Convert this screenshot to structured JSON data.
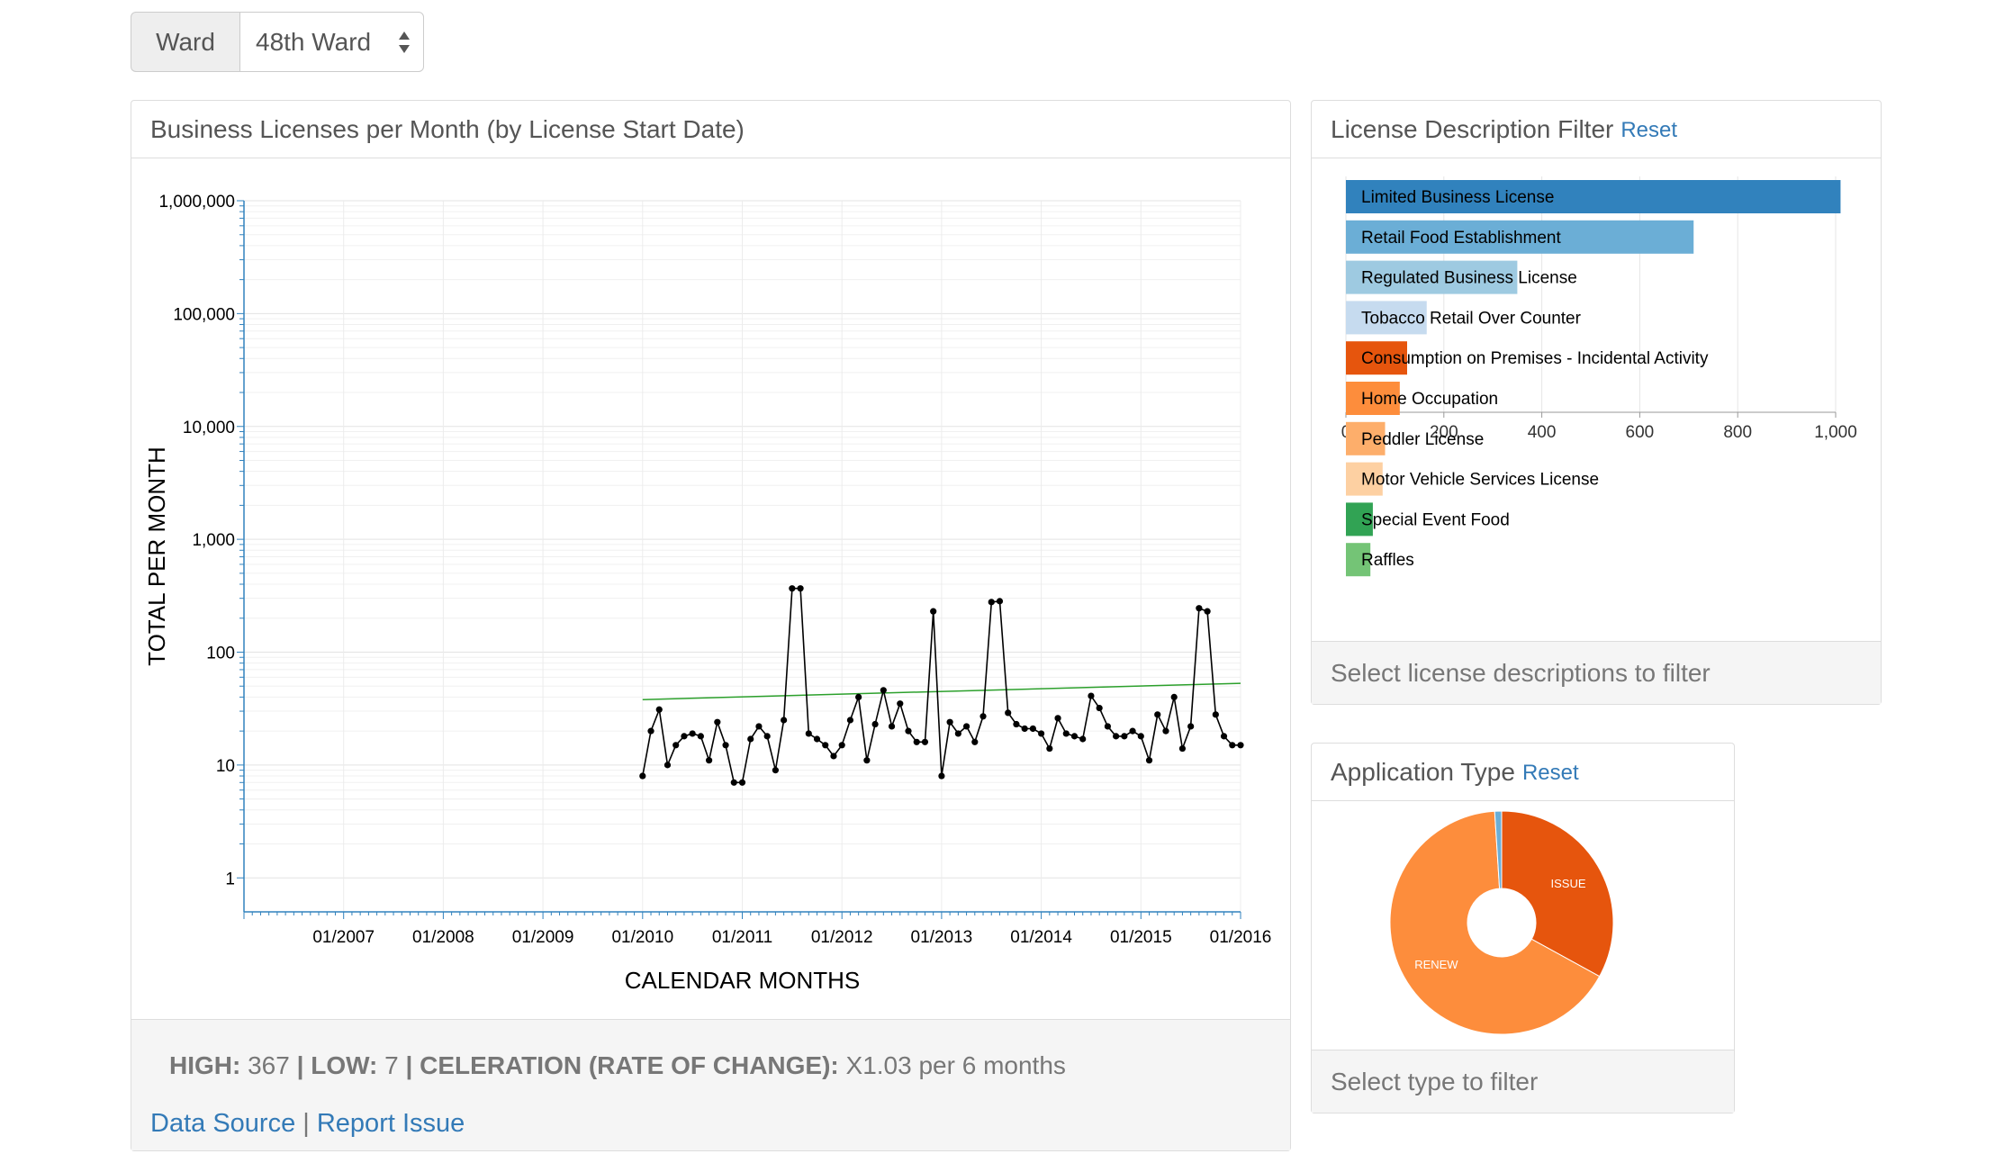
{
  "ward_selector": {
    "label": "Ward",
    "selected": "48th Ward"
  },
  "main_panel": {
    "title": "Business Licenses per Month (by License Start Date)",
    "stats": {
      "high_label": "HIGH:",
      "high_value": "367",
      "low_label": "LOW:",
      "low_value": "7",
      "celeration_label": "CELERATION (RATE OF CHANGE):",
      "celeration_value": "X1.03 per 6 months"
    },
    "links": {
      "data_source": "Data Source",
      "report_issue": "Report Issue"
    }
  },
  "description_panel": {
    "title": "License Description Filter",
    "reset": "Reset",
    "footer": "Select license descriptions to filter"
  },
  "type_panel": {
    "title": "Application Type",
    "reset": "Reset",
    "footer": "Select type to filter"
  },
  "chart_data": [
    {
      "type": "line",
      "scale": "log",
      "xlabel": "CALENDAR MONTHS",
      "ylabel": "TOTAL PER MONTH",
      "xlim": [
        "2006-01",
        "2016-01"
      ],
      "ylim": [
        0.5,
        1000000
      ],
      "y_ticks": [
        1,
        10,
        100,
        1000,
        10000,
        100000,
        1000000
      ],
      "y_tick_labels": [
        "1",
        "10",
        "100",
        "1,000",
        "10,000",
        "100,000",
        "1,000,000"
      ],
      "x_ticks": [
        "2007-01",
        "2008-01",
        "2009-01",
        "2010-01",
        "2011-01",
        "2012-01",
        "2013-01",
        "2014-01",
        "2015-01",
        "2016-01"
      ],
      "x_tick_labels": [
        "01/2007",
        "01/2008",
        "01/2009",
        "01/2010",
        "01/2011",
        "01/2012",
        "01/2013",
        "01/2014",
        "01/2015",
        "01/2016"
      ],
      "grid": true,
      "series": [
        {
          "color": "#000000",
          "x": [
            "2010-01",
            "2010-02",
            "2010-03",
            "2010-04",
            "2010-05",
            "2010-06",
            "2010-07",
            "2010-08",
            "2010-09",
            "2010-10",
            "2010-11",
            "2010-12",
            "2011-01",
            "2011-02",
            "2011-03",
            "2011-04",
            "2011-05",
            "2011-06",
            "2011-07",
            "2011-08",
            "2011-09",
            "2011-10",
            "2011-11",
            "2011-12",
            "2012-01",
            "2012-02",
            "2012-03",
            "2012-04",
            "2012-05",
            "2012-06",
            "2012-07",
            "2012-08",
            "2012-09",
            "2012-10",
            "2012-11",
            "2012-12",
            "2013-01",
            "2013-02",
            "2013-03",
            "2013-04",
            "2013-05",
            "2013-06",
            "2013-07",
            "2013-08",
            "2013-09",
            "2013-10",
            "2013-11",
            "2013-12",
            "2014-01",
            "2014-02",
            "2014-03",
            "2014-04",
            "2014-05",
            "2014-06",
            "2014-07",
            "2014-08",
            "2014-09",
            "2014-10",
            "2014-11",
            "2014-12",
            "2015-01",
            "2015-02",
            "2015-03",
            "2015-04",
            "2015-05",
            "2015-06",
            "2015-07",
            "2015-08",
            "2015-09",
            "2015-10",
            "2015-11",
            "2015-12",
            "2016-01"
          ],
          "values": [
            8,
            20,
            31,
            10,
            15,
            18,
            19,
            18,
            11,
            24,
            15,
            7,
            7,
            17,
            22,
            18,
            9,
            25,
            367,
            367,
            19,
            17,
            15,
            12,
            15,
            25,
            40,
            11,
            23,
            46,
            22,
            35,
            20,
            16,
            16,
            230,
            8,
            24,
            19,
            22,
            16,
            27,
            278,
            283,
            29,
            23,
            21,
            21,
            19,
            14,
            26,
            19,
            18,
            17,
            41,
            32,
            22,
            18,
            18,
            20,
            18,
            11,
            28,
            20,
            40,
            14,
            22,
            245,
            230,
            28,
            18,
            15,
            15
          ]
        },
        {
          "color": "#2ca02c",
          "x": [
            "2010-01",
            "2016-01"
          ],
          "values": [
            38,
            53
          ]
        }
      ]
    },
    {
      "type": "bar",
      "orientation": "horizontal",
      "categories": [
        "Limited Business License",
        "Retail Food Establishment",
        "Regulated Business License",
        "Tobacco Retail Over Counter",
        "Consumption on Premises - Incidental Activity",
        "Home Occupation",
        "Peddler License",
        "Motor Vehicle Services License",
        "Special Event Food",
        "Raffles"
      ],
      "values": [
        1010,
        710,
        350,
        165,
        125,
        110,
        80,
        75,
        55,
        50
      ],
      "colors": [
        "#3182bd",
        "#6baed6",
        "#9ecae1",
        "#c6dbef",
        "#e6550d",
        "#fd8d3c",
        "#fdae6b",
        "#fdd0a2",
        "#31a354",
        "#74c476"
      ],
      "xlim": [
        0,
        1000
      ],
      "x_ticks": [
        0,
        200,
        400,
        600,
        800,
        1000
      ],
      "x_tick_labels": [
        "0",
        "200",
        "400",
        "600",
        "800",
        "1,000"
      ],
      "grid": true
    },
    {
      "type": "pie",
      "donut": true,
      "labels": [
        "ISSUE",
        "RENEW",
        ""
      ],
      "values": [
        33,
        66,
        1
      ],
      "colors": [
        "#e6550d",
        "#fd8d3c",
        "#6baed6"
      ]
    }
  ]
}
